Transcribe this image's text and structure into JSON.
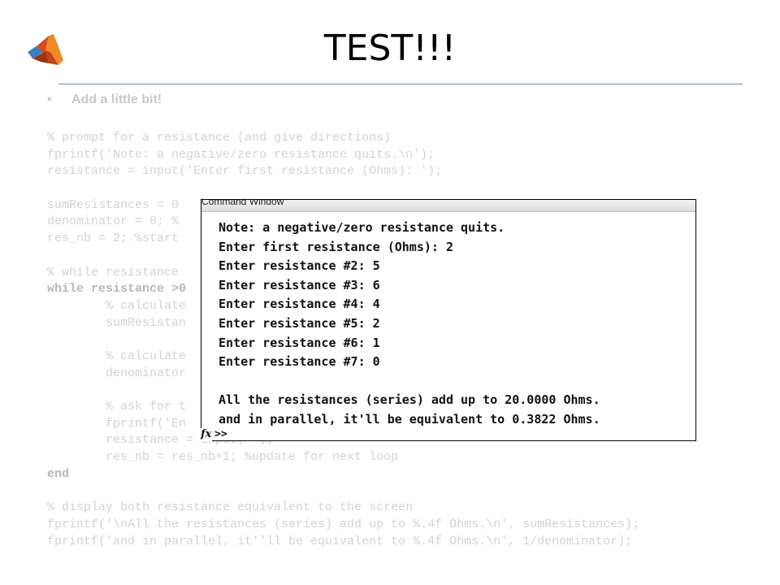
{
  "slide": {
    "title": "TEST!!!",
    "bullet": "Add a little bit!",
    "bullet_symbol": "•"
  },
  "code_lines": [
    "% prompt for a resistance (and give directions)",
    "fprintf('Note: a negative/zero resistance quits.\\n');",
    "resistance = input('Enter first resistance (Ohms): ');",
    "",
    "sumResistances = 0",
    "denominator = 0; %",
    "res_nb = 2; %start",
    "",
    "% while resistance",
    "while resistance >0",
    "        % calculate",
    "        sumResistan",
    "",
    "        % calculate",
    "        denominator",
    "",
    "        % ask for t",
    "        fprintf('En",
    "        resistance = input('');",
    "        res_nb = res_nb+1; %update for next loop",
    "end",
    "",
    "% display both resistance equivalent to the screen",
    "fprintf('\\nAll the resistances (series) add up to %.4f Ohms.\\n', sumResistances);",
    "fprintf('and in parallel, it''ll be equivalent to %.4f Ohms.\\n', 1/denominator);"
  ],
  "command_window": {
    "title": "Command Window",
    "lines": [
      "Note: a negative/zero resistance quits.",
      "Enter first resistance (Ohms): 2",
      "Enter resistance #2: 5",
      "Enter resistance #3: 6",
      "Enter resistance #4: 4",
      "Enter resistance #5: 2",
      "Enter resistance #6: 1",
      "Enter resistance #7: 0",
      "",
      "All the resistances (series) add up to 20.0000 Ohms.",
      "and in parallel, it'll be equivalent to 0.3822 Ohms."
    ],
    "fx_label": "fx",
    "prompt": ">>"
  },
  "colors": {
    "rule": "#6e8fa8",
    "faded_text": "#d2d2d2",
    "matlab_orange": "#e8701a",
    "matlab_blue": "#3c7fc0"
  },
  "icons": {
    "logo": "matlab-logo-icon"
  }
}
